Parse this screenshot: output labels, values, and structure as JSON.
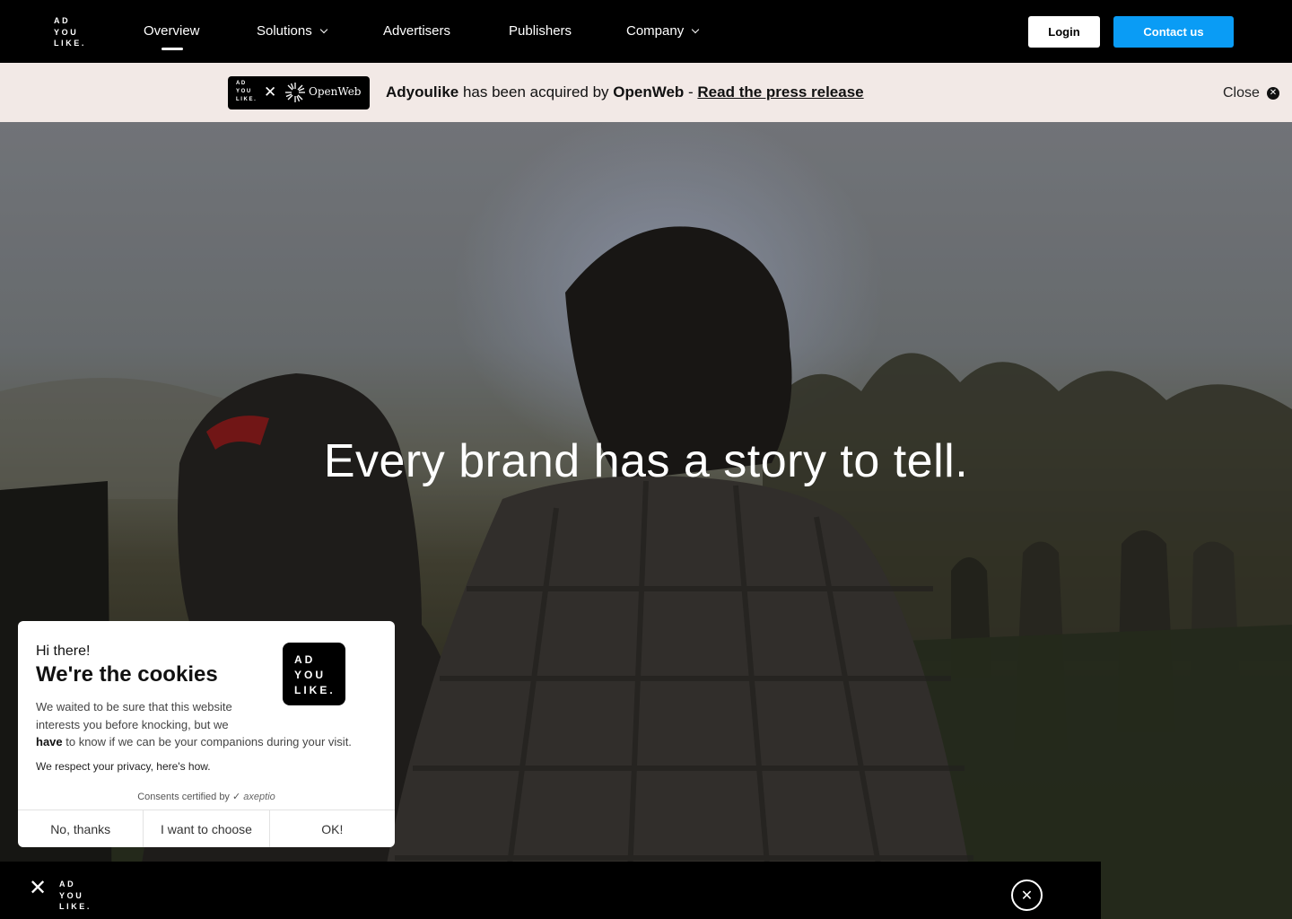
{
  "nav": {
    "logo_lines": [
      "AD",
      "YOU",
      "LIKE."
    ],
    "items": [
      {
        "label": "Overview",
        "has_dropdown": false,
        "active": true
      },
      {
        "label": "Solutions",
        "has_dropdown": true
      },
      {
        "label": "Advertisers",
        "has_dropdown": false
      },
      {
        "label": "Publishers",
        "has_dropdown": false
      },
      {
        "label": "Company",
        "has_dropdown": true
      }
    ],
    "login_label": "Login",
    "contact_label": "Contact us",
    "accent_color": "#0a9cf5"
  },
  "announcement": {
    "logo_lines": [
      "AD",
      "YOU",
      "LIKE."
    ],
    "partner_name": "OpenWeb",
    "brand": "Adyoulike",
    "text_middle": " has been acquired by ",
    "partner": "OpenWeb",
    "separator": " - ",
    "link_label": "Read the press release",
    "close_label": "Close",
    "background": "#f2e9e6"
  },
  "hero": {
    "title": "Every brand has a story to tell."
  },
  "cookie_dialog": {
    "greeting": "Hi there!",
    "title": "We're the cookies",
    "badge_lines": [
      "AD",
      "YOU",
      "LIKE."
    ],
    "body_part1": "We waited to be sure that this website interests you before knocking, but we",
    "body_bold": "have",
    "body_part2": " to know if we can be your companions during your visit.",
    "privacy_link": "We respect your privacy, here's how.",
    "certified_label": "Consents certified by",
    "certified_brand": "axeptio",
    "buttons": {
      "reject": "No, thanks",
      "choose": "I want to choose",
      "accept": "OK!"
    }
  },
  "sticky_bar": {
    "logo_lines": [
      "AD",
      "YOU",
      "LIKE."
    ]
  }
}
